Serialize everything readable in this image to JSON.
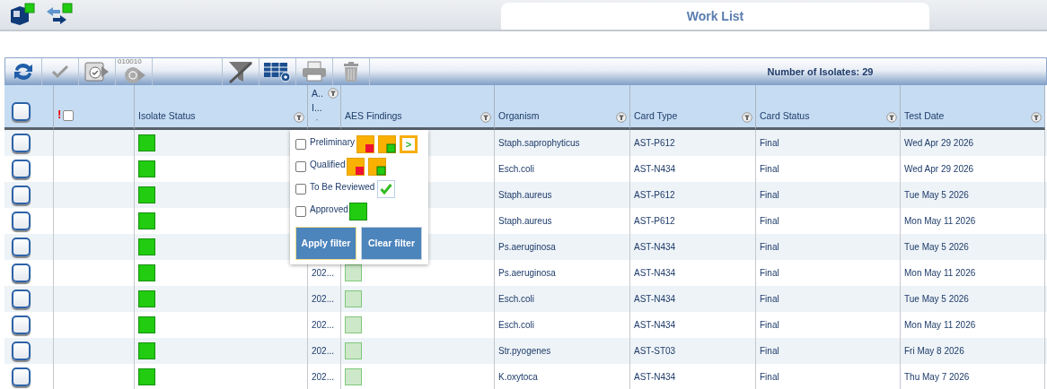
{
  "top_bar": {
    "tabs": [
      {
        "label": "Work List",
        "selected": true
      }
    ]
  },
  "toolbar": {
    "left_buttons": [
      {
        "kind": "refresh",
        "disabled": false
      },
      {
        "kind": "check",
        "disabled": true
      },
      {
        "kind": "approve",
        "disabled": false
      },
      {
        "kind": "export",
        "disabled": true,
        "caption": "010010"
      }
    ],
    "right_buttons": [
      {
        "kind": "filter",
        "disabled": false
      },
      {
        "kind": "columns",
        "disabled": false
      },
      {
        "kind": "print",
        "disabled": true
      },
      {
        "kind": "delete",
        "disabled": true
      }
    ],
    "count_label": "Number of Isolates: 29"
  },
  "table": {
    "select_all": {
      "checked": false
    },
    "columns": [
      {
        "kind": "select"
      },
      {
        "kind": "flag",
        "label": "!",
        "checked": false
      },
      {
        "kind": "text",
        "label": "Isolate Status",
        "filter": true
      },
      {
        "kind": "stack",
        "lines": [
          "A..",
          "I..."
        ],
        "filter": true,
        "sorted_ascending": true
      },
      {
        "kind": "text",
        "label": "AES Findings",
        "filter": true
      },
      {
        "kind": "text",
        "label": "Organism",
        "filter": true
      },
      {
        "kind": "text",
        "label": "Card Type",
        "filter": true
      },
      {
        "kind": "text",
        "label": "Card Status",
        "filter": true
      },
      {
        "kind": "text",
        "label": "Test Date",
        "filter": true
      }
    ],
    "rows": [
      {
        "checked": false,
        "isolate_approved": true,
        "organism": "Staph.saprophyticus",
        "card_type": "AST-P612",
        "card_status": "Final",
        "test_date": "Wed Apr 29 2026"
      },
      {
        "checked": false,
        "isolate_approved": true,
        "organism": "Esch.coli",
        "card_type": "AST-N434",
        "card_status": "Final",
        "test_date": "Wed Apr 29 2026"
      },
      {
        "checked": false,
        "isolate_approved": true,
        "organism": "Staph.aureus",
        "card_type": "AST-P612",
        "card_status": "Final",
        "test_date": "Tue May 5 2026"
      },
      {
        "checked": false,
        "isolate_approved": true,
        "organism": "Staph.aureus",
        "card_type": "AST-P612",
        "card_status": "Final",
        "test_date": "Mon May 11 2026"
      },
      {
        "checked": false,
        "isolate_approved": true,
        "organism": "Ps.aeruginosa",
        "card_type": "AST-N434",
        "card_status": "Final",
        "test_date": "Tue May 5 2026"
      },
      {
        "checked": false,
        "isolate_approved": true,
        "column_4": "202...",
        "aes_approved": true,
        "organism": "Ps.aeruginosa",
        "card_type": "AST-N434",
        "card_status": "Final",
        "test_date": "Mon May 11 2026"
      },
      {
        "checked": false,
        "isolate_approved": true,
        "column_4": "202...",
        "aes_approved": true,
        "organism": "Esch.coli",
        "card_type": "AST-N434",
        "card_status": "Final",
        "test_date": "Tue May 5 2026"
      },
      {
        "checked": false,
        "isolate_approved": true,
        "column_4": "202...",
        "aes_approved": true,
        "organism": "Esch.coli",
        "card_type": "AST-N434",
        "card_status": "Final",
        "test_date": "Mon May 11 2026"
      },
      {
        "checked": false,
        "isolate_approved": true,
        "column_4": "202...",
        "aes_approved": true,
        "organism": "Str.pyogenes",
        "card_type": "AST-ST03",
        "card_status": "Final",
        "test_date": "Fri May 8 2026"
      },
      {
        "checked": false,
        "isolate_approved": true,
        "column_4": "202...",
        "aes_approved": true,
        "organism": "K.oxytoca",
        "card_type": "AST-N434",
        "card_status": "Final",
        "test_date": "Thu May 7 2026"
      }
    ]
  },
  "filter_popup": {
    "options": [
      {
        "label": "Preliminary",
        "checked": false,
        "icons": [
          {
            "kind": "red_corner"
          },
          {
            "kind": "green_corner"
          },
          {
            "kind": "next",
            "text": ">"
          }
        ]
      },
      {
        "label": "Qualified",
        "checked": false,
        "icons": [
          {
            "kind": "red_corner"
          },
          {
            "kind": "green_corner"
          }
        ]
      },
      {
        "label": "To Be Reviewed",
        "checked": false,
        "icons": [
          {
            "kind": "check"
          }
        ]
      },
      {
        "label": "Approved",
        "checked": false,
        "icons": [
          {
            "kind": "approved"
          }
        ]
      }
    ],
    "buttons": [
      {
        "label": "Apply filter",
        "focused": true
      },
      {
        "label": "Clear filter",
        "focused": false
      }
    ]
  }
}
